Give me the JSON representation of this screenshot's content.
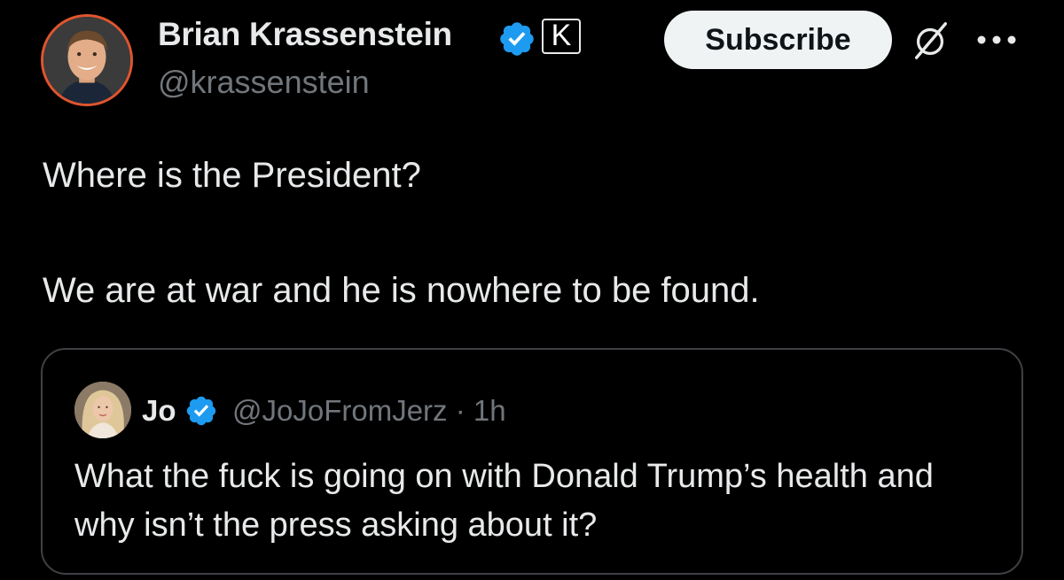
{
  "author": {
    "display_name": "Brian Krassenstein",
    "handle": "@krassenstein",
    "verified": true,
    "affiliate_badge_letter": "K",
    "avatar_icon": "profile-photo"
  },
  "actions": {
    "subscribe_label": "Subscribe",
    "grok_icon": "grok-icon",
    "more_icon": "more-horizontal-icon"
  },
  "post": {
    "line1": "Where is the President?",
    "line2": "We are at war and he is nowhere to be found."
  },
  "quote": {
    "display_name": "Jo",
    "verified": true,
    "handle_time": "@JoJoFromJerz · 1h",
    "text": "What the fuck is going on with Donald Trump’s health and why isn’t the press asking about it?"
  },
  "colors": {
    "background": "#000000",
    "text_primary": "#e7e9ea",
    "text_secondary": "#71767b",
    "verified_blue": "#1d9bf0",
    "subscribe_bg": "#eff3f4",
    "avatar_ring": "#e0552f",
    "card_border": "#3e4144"
  }
}
